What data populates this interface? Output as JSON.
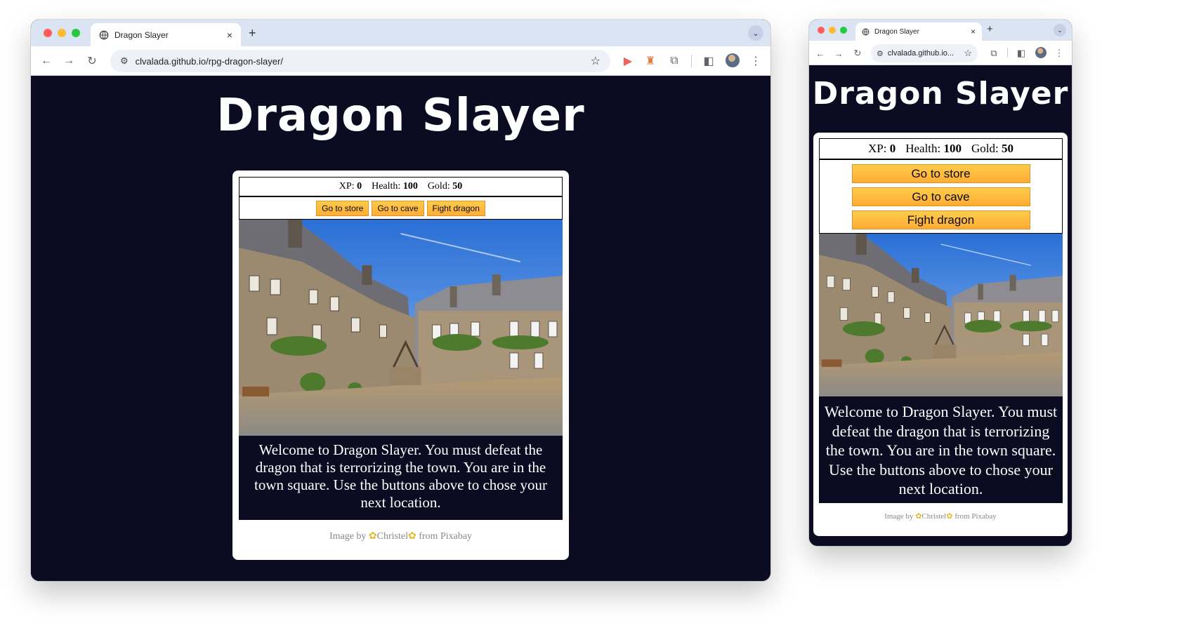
{
  "browser": {
    "tab_title": "Dragon Slayer",
    "url": "clvalada.github.io/rpg-dragon-slayer/",
    "url_truncated": "clvalada.github.io...",
    "close_glyph": "×",
    "new_tab_glyph": "+"
  },
  "game": {
    "title": "Dragon Slayer",
    "stats": {
      "xp_label": "XP:",
      "xp_value": "0",
      "health_label": "Health:",
      "health_value": "100",
      "gold_label": "Gold:",
      "gold_value": "50"
    },
    "buttons": {
      "store": "Go to store",
      "cave": "Go to cave",
      "dragon": "Fight dragon"
    },
    "text": "Welcome to Dragon Slayer. You must defeat the dragon that is terrorizing the town. You are in the town square. Use the buttons above to chose your next location.",
    "credit": {
      "prefix": "Image by",
      "author": "Christel",
      "suffix": "from Pixabay"
    }
  },
  "colors": {
    "page_background": "#0b0b22",
    "button_top": "#fecc4c",
    "button_bottom": "#ffac33",
    "tab_bar": "#dbe4f3"
  },
  "icons": [
    "back-icon",
    "forward-icon",
    "reload-icon",
    "site-settings-icon",
    "bookmark-star-icon",
    "extension-icon",
    "puzzle-extensions-icon",
    "side-panel-icon",
    "profile-avatar",
    "more-menu-icon",
    "globe-icon"
  ]
}
